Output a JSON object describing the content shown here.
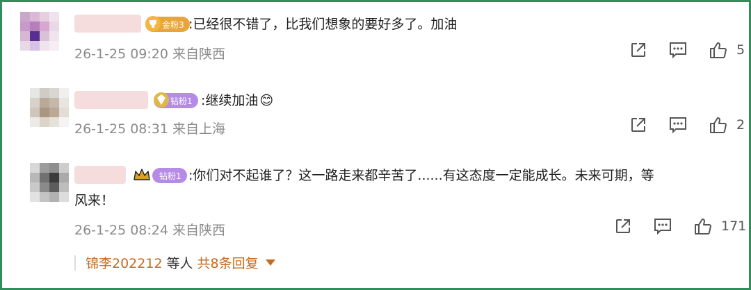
{
  "comments": [
    {
      "badge": "金粉3",
      "text": ":已经很不错了，比我们想象的要好多了。加油",
      "time": "26-1-25 09:20",
      "location": "来自陕西",
      "likes": "5"
    },
    {
      "badge": "钻粉1",
      "text": ":继续加油",
      "emoji": "😊",
      "time": "26-1-25 08:31",
      "location": "来自上海",
      "likes": "2"
    },
    {
      "badge": "钻粉1",
      "text_line1": ":你们对不起谁了？这一路走来都辛苦了......有这态度一定能成长。未来可期，等",
      "text_line2": "风来！",
      "time": "26-1-25 08:24",
      "location": "来自陕西",
      "likes": "171"
    }
  ],
  "replies": {
    "who": "锦李202212",
    "etc": "等人",
    "count": "共8条回复"
  },
  "colors": {
    "frame": "#2f8f5b",
    "badge_gold": "#e8a53a",
    "badge_diamond": "#b58be6",
    "link": "#c56a1e"
  },
  "icons": [
    "share-icon",
    "comment-icon",
    "like-icon",
    "crown-icon",
    "caret-down-icon"
  ]
}
